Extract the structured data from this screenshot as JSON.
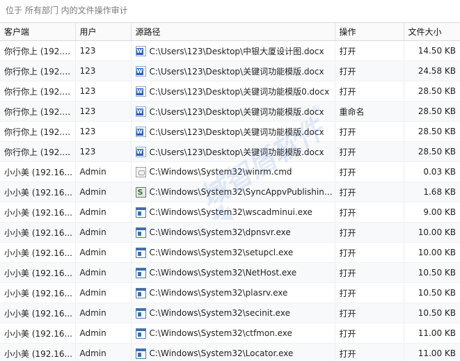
{
  "header": {
    "title": "位于 所有部门 内的文件操作审计"
  },
  "columns": [
    "客户端",
    "用户",
    "源路径",
    "操作",
    "文件大小"
  ],
  "rows": [
    {
      "client": "你行你上 (192.1...",
      "user": "123",
      "icon": "word-doc-icon",
      "path": "C:\\Users\\123\\Desktop\\中银大厦设计图.docx",
      "op": "打开",
      "size": "14.50 KB"
    },
    {
      "client": "你行你上 (192.1...",
      "user": "123",
      "icon": "word-doc-icon",
      "path": "C:\\Users\\123\\Desktop\\关键词功能模版.docx",
      "op": "打开",
      "size": "24.58 KB"
    },
    {
      "client": "你行你上 (192.1...",
      "user": "123",
      "icon": "word-doc-icon",
      "path": "C:\\Users\\123\\Desktop\\关键词功能模版0.docx",
      "op": "打开",
      "size": "28.50 KB"
    },
    {
      "client": "你行你上 (192.1...",
      "user": "123",
      "icon": "word-doc-icon",
      "path": "C:\\Users\\123\\Desktop\\关键词功能模版.docx",
      "op": "重命名",
      "size": "28.50 KB"
    },
    {
      "client": "你行你上 (192.1...",
      "user": "123",
      "icon": "word-doc-icon",
      "path": "C:\\Users\\123\\Desktop\\关键词功能模版.docx",
      "op": "打开",
      "size": "28.50 KB"
    },
    {
      "client": "你行你上 (192.1...",
      "user": "123",
      "icon": "word-doc-icon",
      "path": "C:\\Users\\123\\Desktop\\关键词功能模版.docx",
      "op": "打开",
      "size": "28.50 KB"
    },
    {
      "client": "小小美 (192.16...",
      "user": "Admin",
      "icon": "cmd-file-icon",
      "path": "C:\\Windows\\System32\\winrm.cmd",
      "op": "打开",
      "size": "0.03 KB"
    },
    {
      "client": "小小美 (192.16...",
      "user": "Admin",
      "icon": "script-file-icon",
      "path": "C:\\Windows\\System32\\SyncAppvPublishing...",
      "op": "打开",
      "size": "1.68 KB"
    },
    {
      "client": "小小美 (192.16...",
      "user": "Admin",
      "icon": "exe-file-icon",
      "path": "C:\\Windows\\System32\\wscadminui.exe",
      "op": "打开",
      "size": "9.00 KB"
    },
    {
      "client": "小小美 (192.16...",
      "user": "Admin",
      "icon": "exe-file-icon",
      "path": "C:\\Windows\\System32\\dpnsvr.exe",
      "op": "打开",
      "size": "10.00 KB"
    },
    {
      "client": "小小美 (192.16...",
      "user": "Admin",
      "icon": "exe-file-icon",
      "path": "C:\\Windows\\System32\\setupcl.exe",
      "op": "打开",
      "size": "10.00 KB"
    },
    {
      "client": "小小美 (192.16...",
      "user": "Admin",
      "icon": "exe-file-icon",
      "path": "C:\\Windows\\System32\\NetHost.exe",
      "op": "打开",
      "size": "10.50 KB"
    },
    {
      "client": "小小美 (192.16...",
      "user": "Admin",
      "icon": "exe-file-icon",
      "path": "C:\\Windows\\System32\\plasrv.exe",
      "op": "打开",
      "size": "10.50 KB"
    },
    {
      "client": "小小美 (192.16...",
      "user": "Admin",
      "icon": "exe-file-icon",
      "path": "C:\\Windows\\System32\\secinit.exe",
      "op": "打开",
      "size": "10.50 KB"
    },
    {
      "client": "小小美 (192.16...",
      "user": "Admin",
      "icon": "exe-file-icon",
      "path": "C:\\Windows\\System32\\ctfmon.exe",
      "op": "打开",
      "size": "11.00 KB"
    },
    {
      "client": "小小美 (192.16...",
      "user": "Admin",
      "icon": "exe-file-icon",
      "path": "C:\\Windows\\System32\\Locator.exe",
      "op": "打开",
      "size": "11.00 KB"
    }
  ],
  "watermark": {
    "text": "域智盾软件",
    "mark": "®"
  },
  "colors": {
    "header_bg": "#fafafa",
    "stripe_bg": "#f7f9fb",
    "word_blue": "#2b5fb8",
    "exe_blue": "#3a6fb5",
    "watermark": "#3a6fd8"
  }
}
